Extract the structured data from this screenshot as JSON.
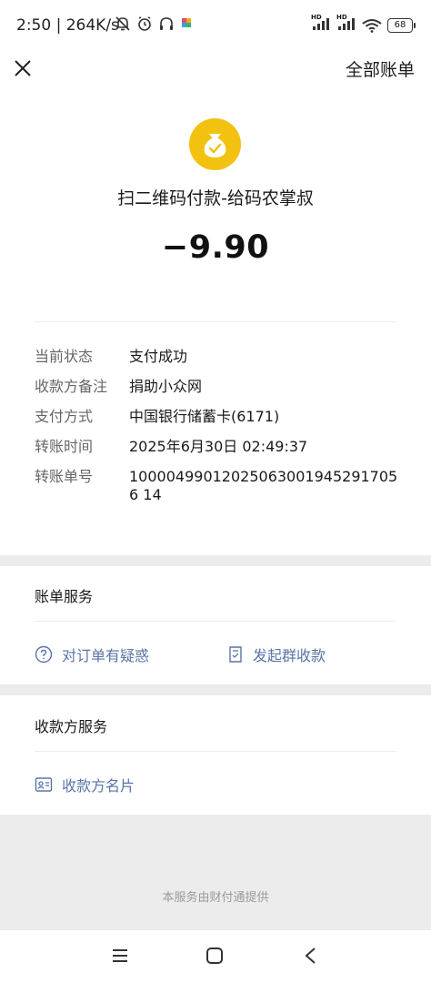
{
  "status_bar": {
    "time": "2:50",
    "speed": "264K/s",
    "battery": "68"
  },
  "header": {
    "all_bills": "全部账单"
  },
  "payment": {
    "merchant": "扫二维码付款-给码农掌叔",
    "amount": "−9.90"
  },
  "details": [
    {
      "label": "当前状态",
      "value": "支付成功"
    },
    {
      "label": "收款方备注",
      "value": "捐助小众网"
    },
    {
      "label": "支付方式",
      "value": "中国银行储蓄卡(6171)"
    },
    {
      "label": "转账时间",
      "value": "2025年6月30日 02:49:37"
    },
    {
      "label": "转账单号",
      "value": "100004990120250630019452917056 14"
    }
  ],
  "bill_service": {
    "title": "账单服务",
    "question_link": "对订单有疑惑",
    "group_collect_link": "发起群收款"
  },
  "payee_service": {
    "title": "收款方服务",
    "payee_card_link": "收款方名片"
  },
  "footer": {
    "provider": "本服务由财付通提供"
  },
  "colors": {
    "accent_link": "#5a74a6",
    "coin_yellow": "#f3c10f"
  }
}
